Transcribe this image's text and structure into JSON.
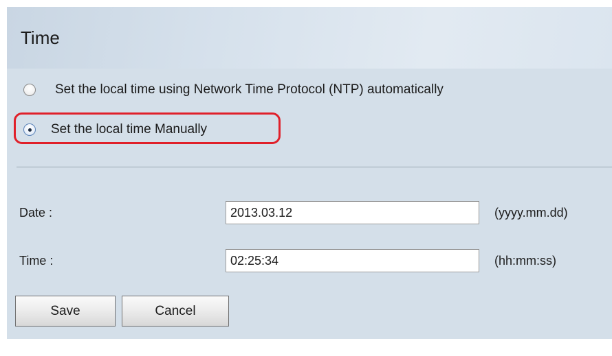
{
  "section": {
    "title": "Time"
  },
  "time_mode": {
    "options": [
      {
        "label": "Set the local time using Network Time Protocol (NTP) automatically",
        "selected": false
      },
      {
        "label": "Set the local time Manually",
        "selected": true
      }
    ]
  },
  "form": {
    "date": {
      "label": "Date :",
      "value": "2013.03.12",
      "hint": "(yyyy.mm.dd)"
    },
    "time": {
      "label": "Time :",
      "value": "02:25:34",
      "hint": "(hh:mm:ss)"
    }
  },
  "buttons": {
    "save_label": "Save",
    "cancel_label": "Cancel"
  },
  "colors": {
    "panel_background": "#d4dfe9",
    "highlight": "#e0202a"
  },
  "icons": {
    "radio_unselected": "radio-button-unselected",
    "radio_selected": "radio-button-selected"
  }
}
